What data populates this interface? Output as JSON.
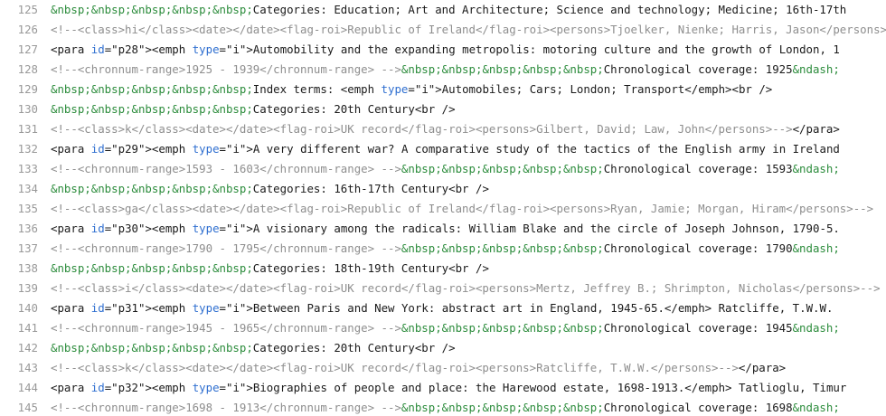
{
  "colors": {
    "entity": "#2c8c3c",
    "attribute": "#2f6fd0",
    "comment": "#8e8e8e",
    "text": "#1a1a1a",
    "gutter": "#999999"
  },
  "lines": [
    {
      "num": "125",
      "tokens": [
        {
          "t": "ent",
          "v": "&nbsp;&nbsp;&nbsp;&nbsp;&nbsp;"
        },
        {
          "t": "text",
          "v": "Categories: Education; Art and Architecture; Science and technology; Medicine; 16th-17th"
        }
      ]
    },
    {
      "num": "126",
      "tokens": [
        {
          "t": "comment",
          "v": "<!--<class>hi</class><date></date><flag-roi>Republic of Ireland</flag-roi><persons>Tjoelker, Nienke; Harris, Jason</persons>-->"
        }
      ]
    },
    {
      "num": "127",
      "tokens": [
        {
          "t": "tag",
          "v": "<para "
        },
        {
          "t": "attr",
          "v": "id"
        },
        {
          "t": "tag",
          "v": "="
        },
        {
          "t": "str",
          "v": "\"p28\""
        },
        {
          "t": "tag",
          "v": "><emph "
        },
        {
          "t": "attr",
          "v": "type"
        },
        {
          "t": "tag",
          "v": "="
        },
        {
          "t": "str",
          "v": "\"i\""
        },
        {
          "t": "tag",
          "v": ">"
        },
        {
          "t": "text",
          "v": "Automobility and the expanding metropolis: motoring culture and the growth of London, 1"
        }
      ]
    },
    {
      "num": "128",
      "tokens": [
        {
          "t": "comment",
          "v": "<!--<chronnum-range>1925 - 1939</chronnum-range> -->"
        },
        {
          "t": "ent",
          "v": "&nbsp;&nbsp;&nbsp;&nbsp;&nbsp;"
        },
        {
          "t": "text",
          "v": "Chronological coverage: 1925"
        },
        {
          "t": "ent",
          "v": "&ndash;"
        }
      ]
    },
    {
      "num": "129",
      "tokens": [
        {
          "t": "ent",
          "v": "&nbsp;&nbsp;&nbsp;&nbsp;&nbsp;"
        },
        {
          "t": "text",
          "v": "Index terms: "
        },
        {
          "t": "tag",
          "v": "<emph "
        },
        {
          "t": "attr",
          "v": "type"
        },
        {
          "t": "tag",
          "v": "="
        },
        {
          "t": "str",
          "v": "\"i\""
        },
        {
          "t": "tag",
          "v": ">"
        },
        {
          "t": "text",
          "v": "Automobiles; Cars; London; Transport"
        },
        {
          "t": "tag",
          "v": "</emph><br />"
        }
      ]
    },
    {
      "num": "130",
      "tokens": [
        {
          "t": "ent",
          "v": "&nbsp;&nbsp;&nbsp;&nbsp;&nbsp;"
        },
        {
          "t": "text",
          "v": "Categories: 20th Century"
        },
        {
          "t": "tag",
          "v": "<br />"
        }
      ]
    },
    {
      "num": "131",
      "tokens": [
        {
          "t": "comment",
          "v": "<!--<class>k</class><date></date><flag-roi>UK record</flag-roi><persons>Gilbert, David; Law, John</persons>-->"
        },
        {
          "t": "tag",
          "v": "</para>"
        }
      ]
    },
    {
      "num": "132",
      "tokens": [
        {
          "t": "tag",
          "v": "<para "
        },
        {
          "t": "attr",
          "v": "id"
        },
        {
          "t": "tag",
          "v": "="
        },
        {
          "t": "str",
          "v": "\"p29\""
        },
        {
          "t": "tag",
          "v": "><emph "
        },
        {
          "t": "attr",
          "v": "type"
        },
        {
          "t": "tag",
          "v": "="
        },
        {
          "t": "str",
          "v": "\"i\""
        },
        {
          "t": "tag",
          "v": ">"
        },
        {
          "t": "text",
          "v": "A very different war? A comparative study of the tactics of the English army in Ireland"
        }
      ]
    },
    {
      "num": "133",
      "tokens": [
        {
          "t": "comment",
          "v": "<!--<chronnum-range>1593 - 1603</chronnum-range> -->"
        },
        {
          "t": "ent",
          "v": "&nbsp;&nbsp;&nbsp;&nbsp;&nbsp;"
        },
        {
          "t": "text",
          "v": "Chronological coverage: 1593"
        },
        {
          "t": "ent",
          "v": "&ndash;"
        }
      ]
    },
    {
      "num": "134",
      "tokens": [
        {
          "t": "ent",
          "v": "&nbsp;&nbsp;&nbsp;&nbsp;&nbsp;"
        },
        {
          "t": "text",
          "v": "Categories: 16th-17th Century"
        },
        {
          "t": "tag",
          "v": "<br />"
        }
      ]
    },
    {
      "num": "135",
      "tokens": [
        {
          "t": "comment",
          "v": "<!--<class>ga</class><date></date><flag-roi>Republic of Ireland</flag-roi><persons>Ryan, Jamie; Morgan, Hiram</persons>-->"
        }
      ]
    },
    {
      "num": "136",
      "tokens": [
        {
          "t": "tag",
          "v": "<para "
        },
        {
          "t": "attr",
          "v": "id"
        },
        {
          "t": "tag",
          "v": "="
        },
        {
          "t": "str",
          "v": "\"p30\""
        },
        {
          "t": "tag",
          "v": "><emph "
        },
        {
          "t": "attr",
          "v": "type"
        },
        {
          "t": "tag",
          "v": "="
        },
        {
          "t": "str",
          "v": "\"i\""
        },
        {
          "t": "tag",
          "v": ">"
        },
        {
          "t": "text",
          "v": "A visionary among the radicals: William Blake and the circle of Joseph Johnson, 1790-5."
        }
      ]
    },
    {
      "num": "137",
      "tokens": [
        {
          "t": "comment",
          "v": "<!--<chronnum-range>1790 - 1795</chronnum-range> -->"
        },
        {
          "t": "ent",
          "v": "&nbsp;&nbsp;&nbsp;&nbsp;&nbsp;"
        },
        {
          "t": "text",
          "v": "Chronological coverage: 1790"
        },
        {
          "t": "ent",
          "v": "&ndash;"
        }
      ]
    },
    {
      "num": "138",
      "tokens": [
        {
          "t": "ent",
          "v": "&nbsp;&nbsp;&nbsp;&nbsp;&nbsp;"
        },
        {
          "t": "text",
          "v": "Categories: 18th-19th Century"
        },
        {
          "t": "tag",
          "v": "<br />"
        }
      ]
    },
    {
      "num": "139",
      "tokens": [
        {
          "t": "comment",
          "v": "<!--<class>i</class><date></date><flag-roi>UK record</flag-roi><persons>Mertz, Jeffrey B.; Shrimpton, Nicholas</persons>-->"
        }
      ]
    },
    {
      "num": "140",
      "tokens": [
        {
          "t": "tag",
          "v": "<para "
        },
        {
          "t": "attr",
          "v": "id"
        },
        {
          "t": "tag",
          "v": "="
        },
        {
          "t": "str",
          "v": "\"p31\""
        },
        {
          "t": "tag",
          "v": "><emph "
        },
        {
          "t": "attr",
          "v": "type"
        },
        {
          "t": "tag",
          "v": "="
        },
        {
          "t": "str",
          "v": "\"i\""
        },
        {
          "t": "tag",
          "v": ">"
        },
        {
          "t": "text",
          "v": "Between Paris and New York: abstract art in England, 1945-65."
        },
        {
          "t": "tag",
          "v": "</emph>"
        },
        {
          "t": "text",
          "v": " Ratcliffe, T.W.W."
        }
      ]
    },
    {
      "num": "141",
      "tokens": [
        {
          "t": "comment",
          "v": "<!--<chronnum-range>1945 - 1965</chronnum-range> -->"
        },
        {
          "t": "ent",
          "v": "&nbsp;&nbsp;&nbsp;&nbsp;&nbsp;"
        },
        {
          "t": "text",
          "v": "Chronological coverage: 1945"
        },
        {
          "t": "ent",
          "v": "&ndash;"
        }
      ]
    },
    {
      "num": "142",
      "tokens": [
        {
          "t": "ent",
          "v": "&nbsp;&nbsp;&nbsp;&nbsp;&nbsp;"
        },
        {
          "t": "text",
          "v": "Categories: 20th Century"
        },
        {
          "t": "tag",
          "v": "<br />"
        }
      ]
    },
    {
      "num": "143",
      "tokens": [
        {
          "t": "comment",
          "v": "<!--<class>k</class><date></date><flag-roi>UK record</flag-roi><persons>Ratcliffe, T.W.W.</persons>-->"
        },
        {
          "t": "tag",
          "v": "</para>"
        }
      ]
    },
    {
      "num": "144",
      "tokens": [
        {
          "t": "tag",
          "v": "<para "
        },
        {
          "t": "attr",
          "v": "id"
        },
        {
          "t": "tag",
          "v": "="
        },
        {
          "t": "str",
          "v": "\"p32\""
        },
        {
          "t": "tag",
          "v": "><emph "
        },
        {
          "t": "attr",
          "v": "type"
        },
        {
          "t": "tag",
          "v": "="
        },
        {
          "t": "str",
          "v": "\"i\""
        },
        {
          "t": "tag",
          "v": ">"
        },
        {
          "t": "text",
          "v": "Biographies of people and place: the Harewood estate, 1698-1913."
        },
        {
          "t": "tag",
          "v": "</emph>"
        },
        {
          "t": "text",
          "v": " Tatlioglu, Timur"
        }
      ]
    },
    {
      "num": "145",
      "tokens": [
        {
          "t": "comment",
          "v": "<!--<chronnum-range>1698 - 1913</chronnum-range> -->"
        },
        {
          "t": "ent",
          "v": "&nbsp;&nbsp;&nbsp;&nbsp;&nbsp;"
        },
        {
          "t": "text",
          "v": "Chronological coverage: 1698"
        },
        {
          "t": "ent",
          "v": "&ndash;"
        }
      ]
    }
  ]
}
